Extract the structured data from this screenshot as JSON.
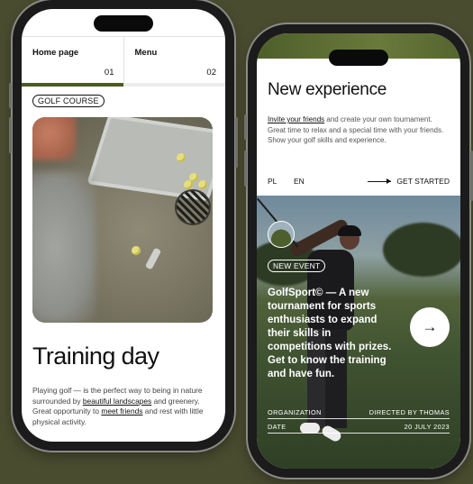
{
  "colors": {
    "background": "#4a4c30",
    "accent": "#4a5a22",
    "text": "#111111"
  },
  "left_screen": {
    "nav": [
      {
        "label": "Home page",
        "number": "01",
        "active": true
      },
      {
        "label": "Menu",
        "number": "02",
        "active": false
      }
    ],
    "tag": "GOLF COURSE",
    "title": "Training day",
    "paragraph": {
      "part1": "Playing golf — is the perfect way to being in nature surrounded by ",
      "link1": "beautiful landscapes",
      "part2": " and greenery. Great opportunity to ",
      "link2": "meet friends",
      "part3": " and rest with little physical activity."
    }
  },
  "right_screen": {
    "title": "New experience",
    "paragraph": {
      "link": "Invite your friends",
      "text": " and create your own tournament. Great time to relax and a special time with your friends. Show your golf skills and experience."
    },
    "languages": [
      "PL",
      "EN"
    ],
    "cta_label": "GET STARTED",
    "event_tag": "NEW EVENT",
    "event_text": "GolfSport© — A new tournament for sports enthusiasts to expand their skills in competitions with prizes. Get to know the training and have fun.",
    "next_arrow": "→",
    "details": [
      {
        "left": "ORGANIZATION",
        "right": "DIRECTED BY THOMAS"
      },
      {
        "left": "DATE",
        "right": "20 JULY 2023"
      }
    ]
  }
}
